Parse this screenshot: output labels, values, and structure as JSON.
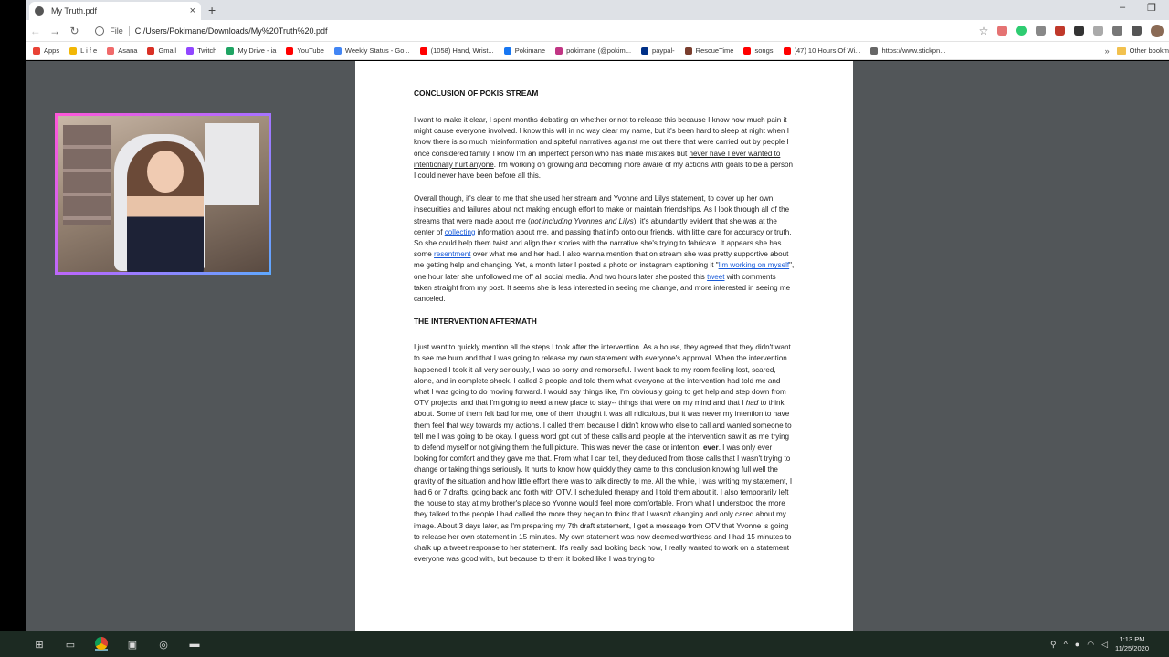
{
  "tab": {
    "title": "My Truth.pdf",
    "close_label": "×",
    "new_tab_label": "+"
  },
  "window": {
    "minimize_label": "–",
    "maximize_label": "❐"
  },
  "address": {
    "scheme": "File",
    "url": "C:/Users/Pokimane/Downloads/My%20Truth%20.pdf"
  },
  "bookmarks": [
    {
      "label": "Apps",
      "color": "#e94235"
    },
    {
      "label": "L i f e",
      "color": "#f2b705"
    },
    {
      "label": "Asana",
      "color": "#f06a6a"
    },
    {
      "label": "Gmail",
      "color": "#d93025"
    },
    {
      "label": "Twitch",
      "color": "#9146ff"
    },
    {
      "label": "My Drive - ia",
      "color": "#1fa463"
    },
    {
      "label": "YouTube",
      "color": "#ff0000"
    },
    {
      "label": "Weekly Status - Go...",
      "color": "#4285f4"
    },
    {
      "label": "(1058) Hand, Wrist...",
      "color": "#ff0000"
    },
    {
      "label": "Pokimane",
      "color": "#1877f2"
    },
    {
      "label": "pokimane (@pokim...",
      "color": "#c13584"
    },
    {
      "label": "paypal-",
      "color": "#003087"
    },
    {
      "label": "RescueTime",
      "color": "#7a3e2e"
    },
    {
      "label": "songs",
      "color": "#ff0000"
    },
    {
      "label": "(47) 10 Hours Of Wi...",
      "color": "#ff0000"
    },
    {
      "label": "https://www.stickpn...",
      "color": "#666666"
    }
  ],
  "bookmarks_more": "»",
  "other_bookmarks": "Other bookm",
  "document": {
    "heading1": "CONCLUSION OF POKIS STREAM",
    "p1": {
      "a": "I want to make it clear, I spent months debating on whether or not to release this because I know how much pain it might cause everyone involved. I know this will in no way clear my name, but it's been hard to sleep at night when I know there is so much misinformation and spiteful narratives against me out there that were carried out by people I once considered family. I know I'm an imperfect person who has made mistakes but ",
      "underlined": "never have I ever wanted to intentionally hurt anyone",
      "b": ". I'm working on growing and becoming more aware of my actions with goals to be a person I could never have been before all this."
    },
    "p2": {
      "a": "Overall though, it's clear to me that she used her stream and Yvonne and Lilys statement, to cover up her own insecurities and failures about not making enough effort to make or maintain friendships. As I look through all of the streams that were made about me (",
      "italic": "not including Yvonnes and Lilys",
      "b": "), it's abundantly evident that she was at the center of ",
      "link1": "collecting",
      "c": " information about me, and passing that info onto our friends, with little care for accuracy or truth. So she could help them twist and align their stories with the narrative she's trying to fabricate. It appears she has some ",
      "link2": "resentment",
      "d": " over what me and her had. I also wanna mention that on stream she was pretty supportive about me getting help and changing. Yet, a month later I posted a photo on instagram captioning it \"",
      "link3": "I'm working on myself",
      "e": "\", one hour later she unfollowed me off all social media. And two hours later she posted this ",
      "link4": "tweet",
      "f": " with comments taken straight from my post. It seems she is less interested in seeing me change, and more interested in seeing me canceled."
    },
    "heading2": "THE INTERVENTION AFTERMATH",
    "p3": {
      "a": "I just want to quickly mention all the steps I took after the intervention. As a house, they agreed that they didn't want to see me burn and that I was going to release my own statement with everyone's approval. When the intervention happened I took it all very seriously, I was so sorry and remorseful. I went back to my room feeling lost, scared, alone, and in complete shock. I called 3 people and told them what everyone at the intervention had told me and what I was going to do moving forward. I would say things like, I'm obviously going to get help and step down from OTV projects, and that I'm going to need a new place to stay-- things that were on my mind and that I ",
      "italic": "had",
      "b": " to think about. Some of them felt bad for me, one of them thought it was all ridiculous, but it was never my intention to have them feel that way towards my actions. I called them because I didn't know who else to call and wanted someone to tell me I was going to be okay. I guess word got out of these calls and people at the intervention saw it as me trying to defend myself or not giving them the full picture. This was never the case or intention, ",
      "bold": "ever",
      "c": ". I was only ever looking for comfort and they gave me that. From what I can tell, they deduced from those calls that I wasn't trying to change or taking things seriously. It hurts to know how quickly they came to this conclusion knowing full well the gravity of the situation and how little effort there was to talk directly to me. All the while, I was writing my statement, I had 6 or 7 drafts, going back and forth with OTV. I scheduled therapy and I told them about it. I also temporarily left the house to stay at my brother's place so Yvonne would feel more comfortable. From what I understood the more they talked to the people I had called the more they began to think that I wasn't changing and only cared about my image. About 3 days later, as I'm preparing my 7th draft statement, I get a message from OTV that Yvonne is going to release her own statement in 15 minutes. My own statement was now deemed worthless and I had 15 minutes to chalk up a tweet response to her statement. It's really sad looking back now, I really wanted to work on a statement everyone was good with, but because to them it looked like I was trying to"
    }
  },
  "taskbar": {
    "time": "1:13 PM",
    "date": "11/25/2020"
  },
  "colors": {
    "webcam_border_start": "#ff57d8",
    "webcam_border_end": "#5fa8ff",
    "link": "#1a5bd8"
  }
}
